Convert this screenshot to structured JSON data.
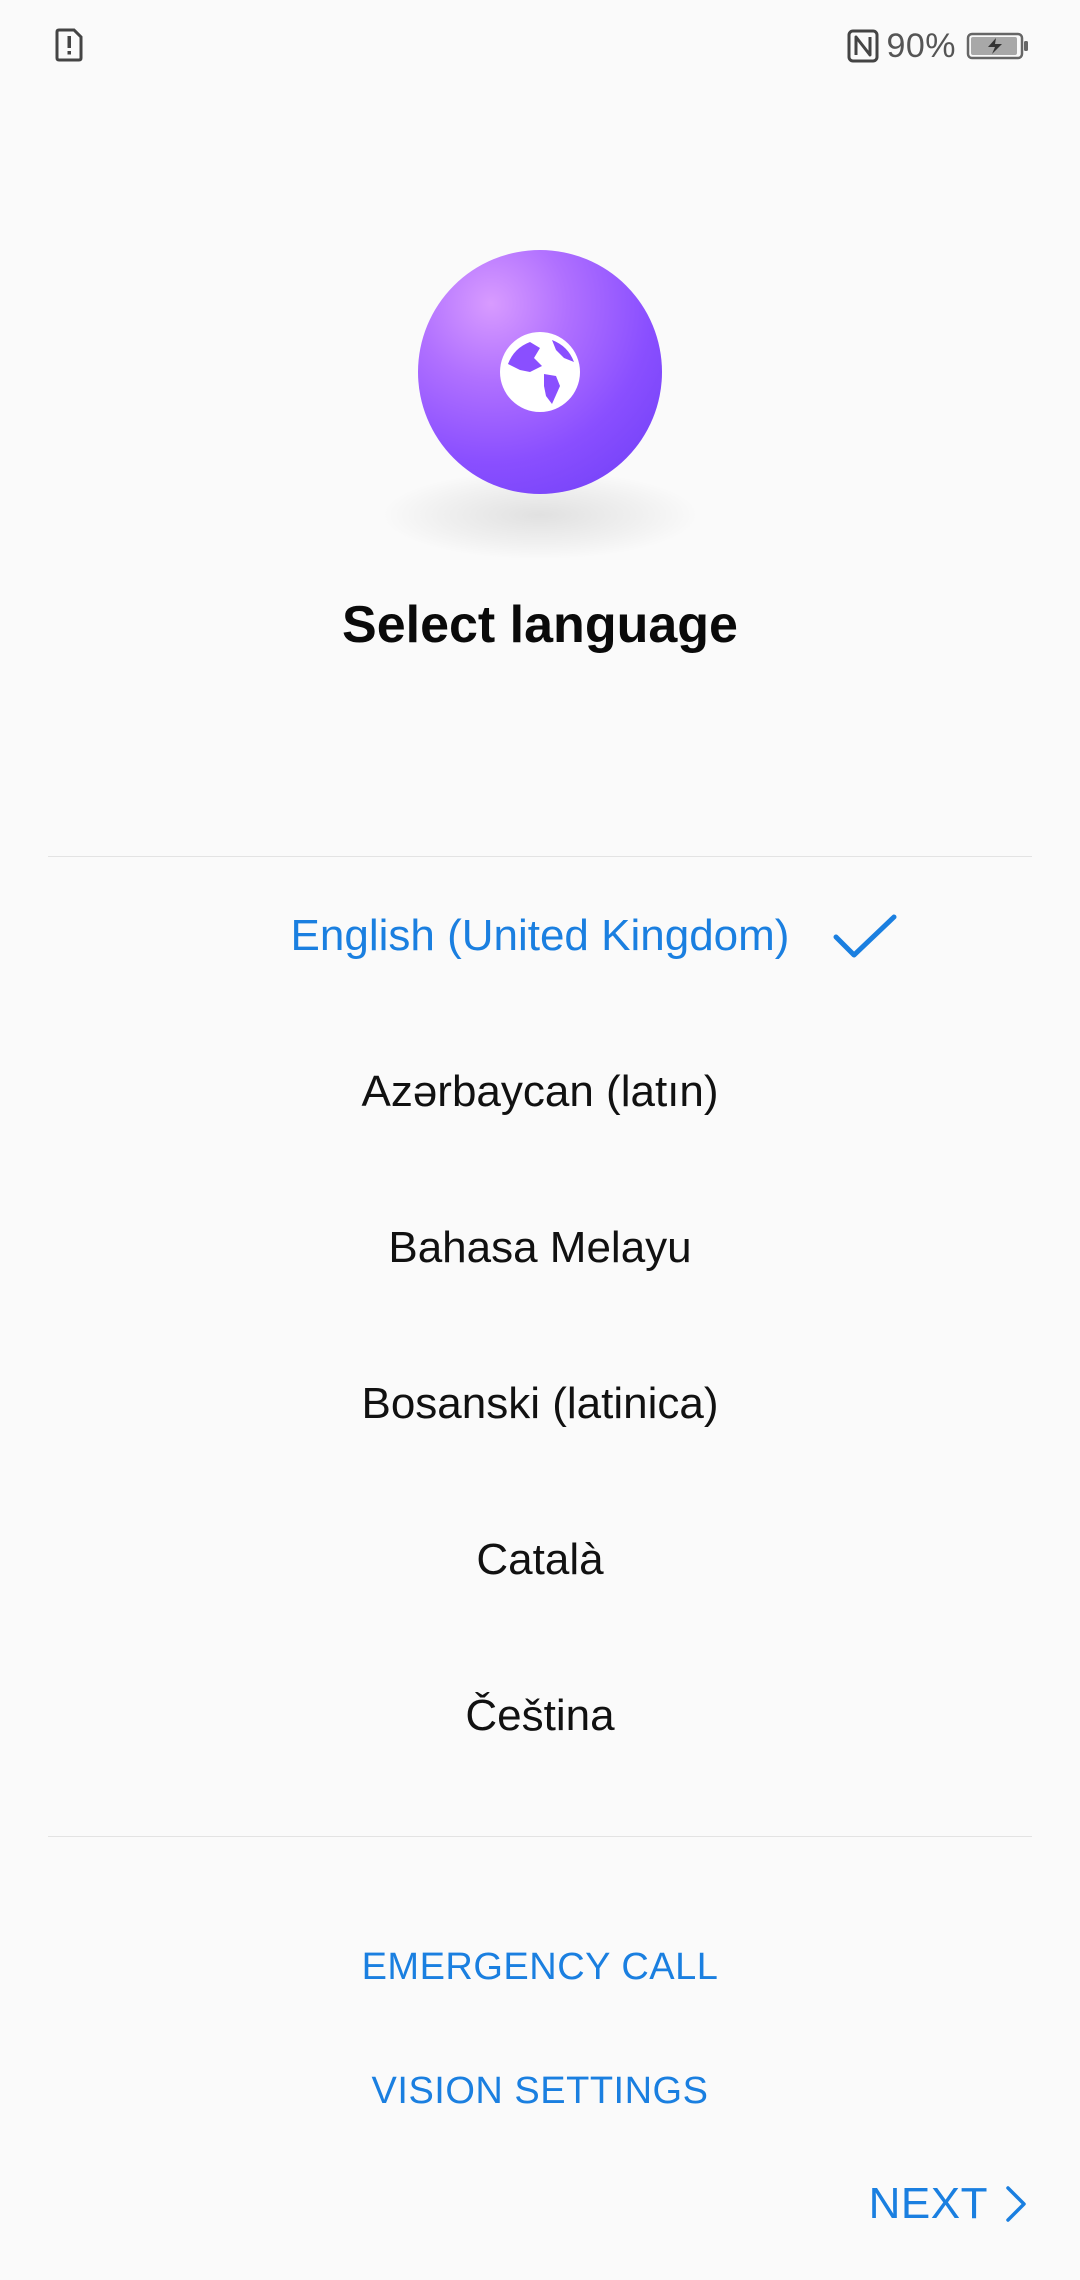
{
  "status_bar": {
    "battery_percent": "90%",
    "icons": [
      "sim-alert-icon",
      "nfc-icon",
      "battery-charging-icon"
    ]
  },
  "hero": {
    "icon": "globe-icon",
    "gradient_colors": [
      "#d89bff",
      "#8a4fff",
      "#6b3cf5"
    ]
  },
  "title": "Select language",
  "languages": [
    {
      "label": "English (United Kingdom)",
      "selected": true
    },
    {
      "label": "Azərbaycan (latın)",
      "selected": false
    },
    {
      "label": "Bahasa Melayu",
      "selected": false
    },
    {
      "label": "Bosanski (latinica)",
      "selected": false
    },
    {
      "label": "Català",
      "selected": false
    },
    {
      "label": "Čeština",
      "selected": false
    }
  ],
  "actions": {
    "emergency_call": "EMERGENCY CALL",
    "vision_settings": "VISION SETTINGS",
    "next": "NEXT"
  },
  "colors": {
    "accent": "#1a7fe0",
    "background": "#fafafa",
    "text": "#111111"
  }
}
